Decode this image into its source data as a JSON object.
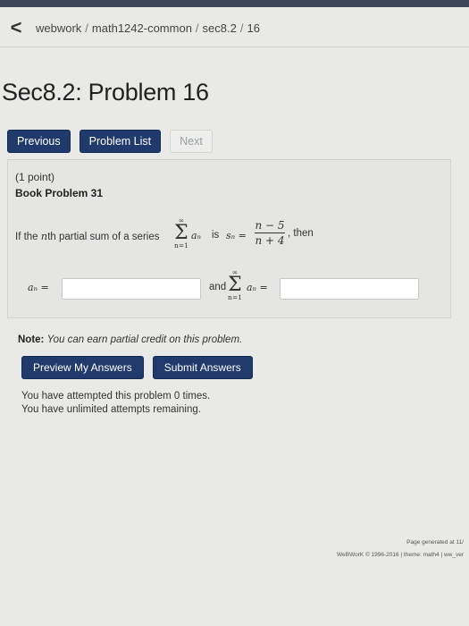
{
  "breadcrumb": {
    "back_glyph": "<",
    "items": [
      "webwork",
      "math1242-common",
      "sec8.2",
      "16"
    ],
    "separator": "/"
  },
  "page": {
    "title": "Sec8.2: Problem 16"
  },
  "nav": {
    "previous_label": "Previous",
    "problem_list_label": "Problem List",
    "next_label": "Next"
  },
  "problem": {
    "points": "(1 point)",
    "book_label": "Book Problem 31",
    "statement_prefix": "If the",
    "nth_var": "n",
    "statement_mid": "th partial sum of a series",
    "sum_upper": "∞",
    "sum_lower": "n=1",
    "sigma": "Σ",
    "term": "aₙ",
    "is_text": "is",
    "sn_lhs": "sₙ =",
    "frac_num": "n − 5",
    "frac_den": "n + 4",
    "then_text": ", then",
    "answer1_lhs": "aₙ =",
    "answer1_value": "",
    "and_text": "and",
    "answer2_lhs": "aₙ =",
    "answer2_value": ""
  },
  "note": {
    "label": "Note:",
    "text": "You can earn partial credit on this problem."
  },
  "submit": {
    "preview_label": "Preview My Answers",
    "submit_label": "Submit Answers"
  },
  "attempts": {
    "line1": "You have attempted this problem 0 times.",
    "line2": "You have unlimited attempts remaining."
  },
  "footer": {
    "line1": "Page generated at 11/",
    "line2": "WeBWorK © 1996-2016 | theme: math4 | ww_ver"
  },
  "colors": {
    "top_band": "#3d4656",
    "button_dark": "#1f3a6b",
    "background": "#e9e9e7"
  }
}
